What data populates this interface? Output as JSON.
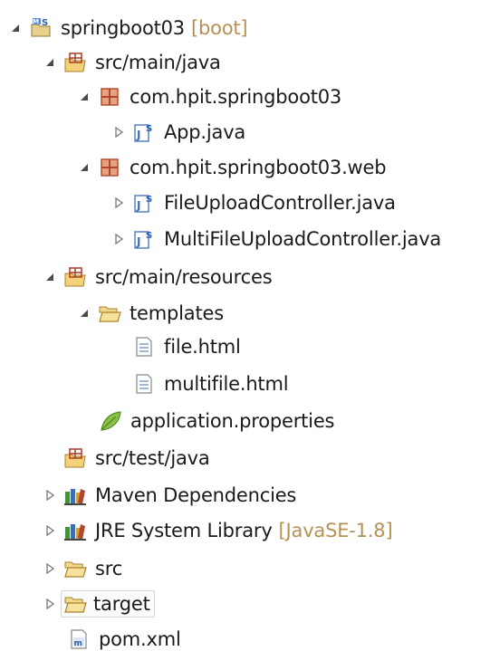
{
  "project": {
    "name": "springboot03",
    "decoration": "[boot]"
  },
  "nodes": {
    "src_main_java": "src/main/java",
    "pkg_main": "com.hpit.springboot03",
    "app_java": "App.java",
    "pkg_web": "com.hpit.springboot03.web",
    "file_upload_controller": "FileUploadController.java",
    "multi_file_upload_controller": "MultiFileUploadController.java",
    "src_main_resources": "src/main/resources",
    "templates": "templates",
    "file_html": "file.html",
    "multifile_html": "multifile.html",
    "application_properties": "application.properties",
    "src_test_java": "src/test/java",
    "maven_dependencies": "Maven Dependencies",
    "jre_system_library": "JRE System Library",
    "jre_decoration": "[JavaSE-1.8]",
    "src": "src",
    "target": "target",
    "pom_xml": "pom.xml"
  },
  "colors": {
    "text": "#1a1a1a",
    "decoration": "#b59154",
    "package_icon": "#b0462b",
    "java_icon": "#3c6fb8",
    "folder_icon": "#e3b54a",
    "leaf_icon": "#7fb23a"
  }
}
